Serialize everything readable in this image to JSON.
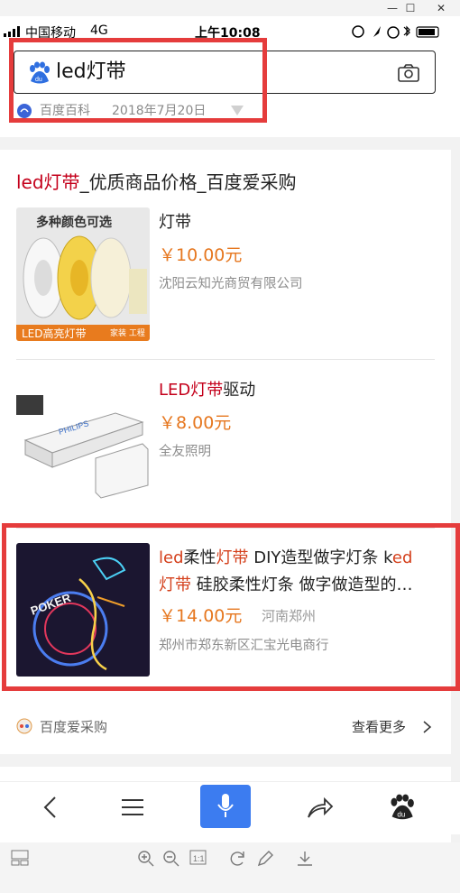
{
  "status_bar": {
    "carrier": "中国移动",
    "network": "4G",
    "time": "上午10:08"
  },
  "search": {
    "query": "led灯带"
  },
  "source": {
    "name": "百度百科",
    "date": "2018年7月20日"
  },
  "result": {
    "title_parts": [
      "led灯带",
      "_优质商品价格_百度爱采购"
    ],
    "products": [
      {
        "title": "灯带",
        "price": "￥10.00元",
        "seller": "沈阳云知光商贸有限公司",
        "thumb_banner_top": "多种颜色可选",
        "thumb_banner_bottom": "LED高亮灯带",
        "thumb_tag": "家装 工程"
      },
      {
        "title_a": "LED灯带",
        "title_b": "驱动",
        "price": "￥8.00元",
        "seller": "全友照明",
        "thumb_brand": "PHILIPS"
      },
      {
        "title_line1_a": "led",
        "title_line1_b": "柔性",
        "title_line1_c": "灯带",
        "title_line1_d": " DIY造型做字灯条 k",
        "title_line1_e": "ed",
        "title_line2_a": "灯带",
        "title_line2_b": " 硅胶柔性灯条 做字做造型的…",
        "price": "￥14.00元",
        "location": "河南郑州",
        "seller": "郑州市郑东新区汇宝光电商行",
        "thumb_text": "POKER"
      }
    ],
    "footer_source": "百度爱采购",
    "more_label": "查看更多"
  },
  "colors": {
    "accent_blue": "#3c7cf0",
    "highlight_red": "#c4001b",
    "price_orange": "#e6771f",
    "annotation_red": "#e53c3c"
  }
}
